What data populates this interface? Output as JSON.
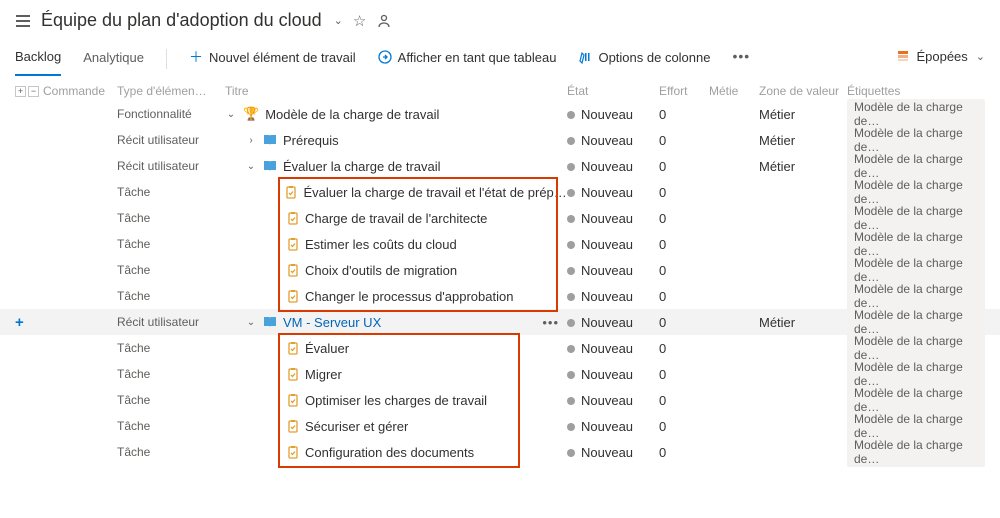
{
  "header": {
    "title": "Équipe du plan d'adoption du cloud"
  },
  "tabs": {
    "backlog": "Backlog",
    "analytics": "Analytique"
  },
  "tools": {
    "new_item": "Nouvel élément de travail",
    "view_as_board": "Afficher en tant que tableau",
    "column_options": "Options de colonne",
    "epics": "Épopées"
  },
  "columns": {
    "order": "Commande",
    "type": "Type d'élémen…",
    "title": "Titre",
    "state": "État",
    "effort": "Effort",
    "profession": "Métie",
    "value_zone": "Zone de valeur",
    "tags": "Étiquettes"
  },
  "common": {
    "state_new": "Nouveau",
    "zone_business": "Métier",
    "tag_workload": "Modèle de la charge de…",
    "type_feature": "Fonctionnalité",
    "type_userstory": "Récit utilisateur",
    "type_task": "Tâche",
    "effort_zero": "0"
  },
  "rows": {
    "r0": "Modèle de la charge de travail",
    "r1": "Prérequis",
    "r2": "Évaluer la charge de travail",
    "r3": "Évaluer la charge de travail et l'état de préparation…",
    "r4": "Charge de travail de l'architecte",
    "r5": "Estimer les coûts du cloud",
    "r6": "Choix d'outils de migration",
    "r7": "Changer le processus d'approbation",
    "r8": "VM - Serveur UX",
    "r9": "Évaluer",
    "r10": "Migrer",
    "r11": "Optimiser les charges de travail",
    "r12": "Sécuriser et gérer",
    "r13": "Configuration des documents"
  }
}
